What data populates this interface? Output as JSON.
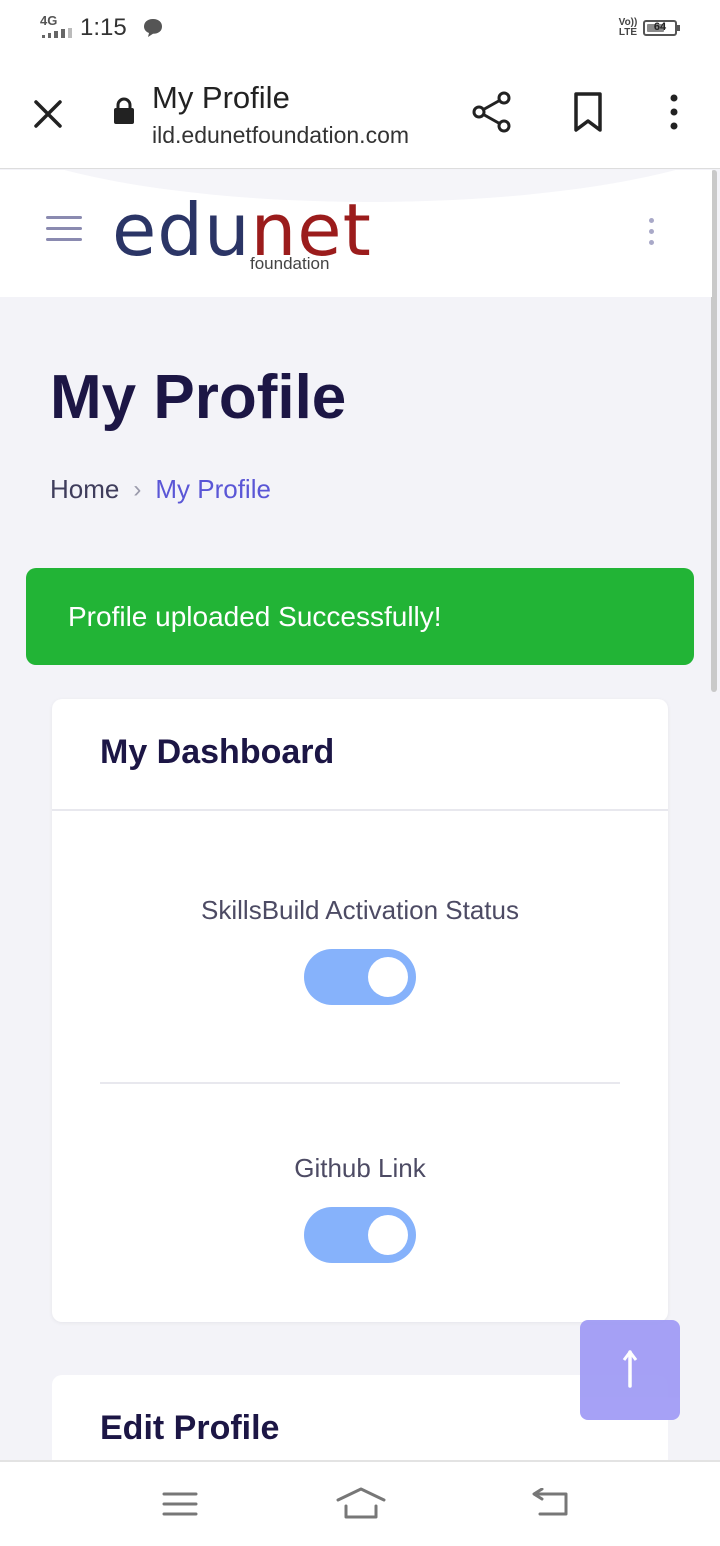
{
  "status_bar": {
    "network": "4G",
    "time": "1:15",
    "volte": "Vo)) LTE",
    "battery": "64",
    "battery_level": 0.64
  },
  "browser": {
    "title": "My Profile",
    "url": "ild.edunetfoundation.com"
  },
  "header": {
    "logo_part1": "edu",
    "logo_part2": "net",
    "logo_sub": "foundation"
  },
  "page": {
    "title": "My Profile",
    "breadcrumb": {
      "home": "Home",
      "separator": "›",
      "current": "My Profile"
    }
  },
  "alert": {
    "message": "Profile uploaded Successfully!",
    "color": "#22b436"
  },
  "dashboard": {
    "title": "My Dashboard",
    "fields": [
      {
        "label": "SkillsBuild Activation Status",
        "enabled": true
      },
      {
        "label": "Github Link",
        "enabled": true
      }
    ]
  },
  "edit_profile": {
    "title": "Edit Profile"
  },
  "colors": {
    "accent": "#5a56d6",
    "toggle": "#86b2fb",
    "scroll_top": "#a19cf5",
    "title": "#1c1645"
  }
}
